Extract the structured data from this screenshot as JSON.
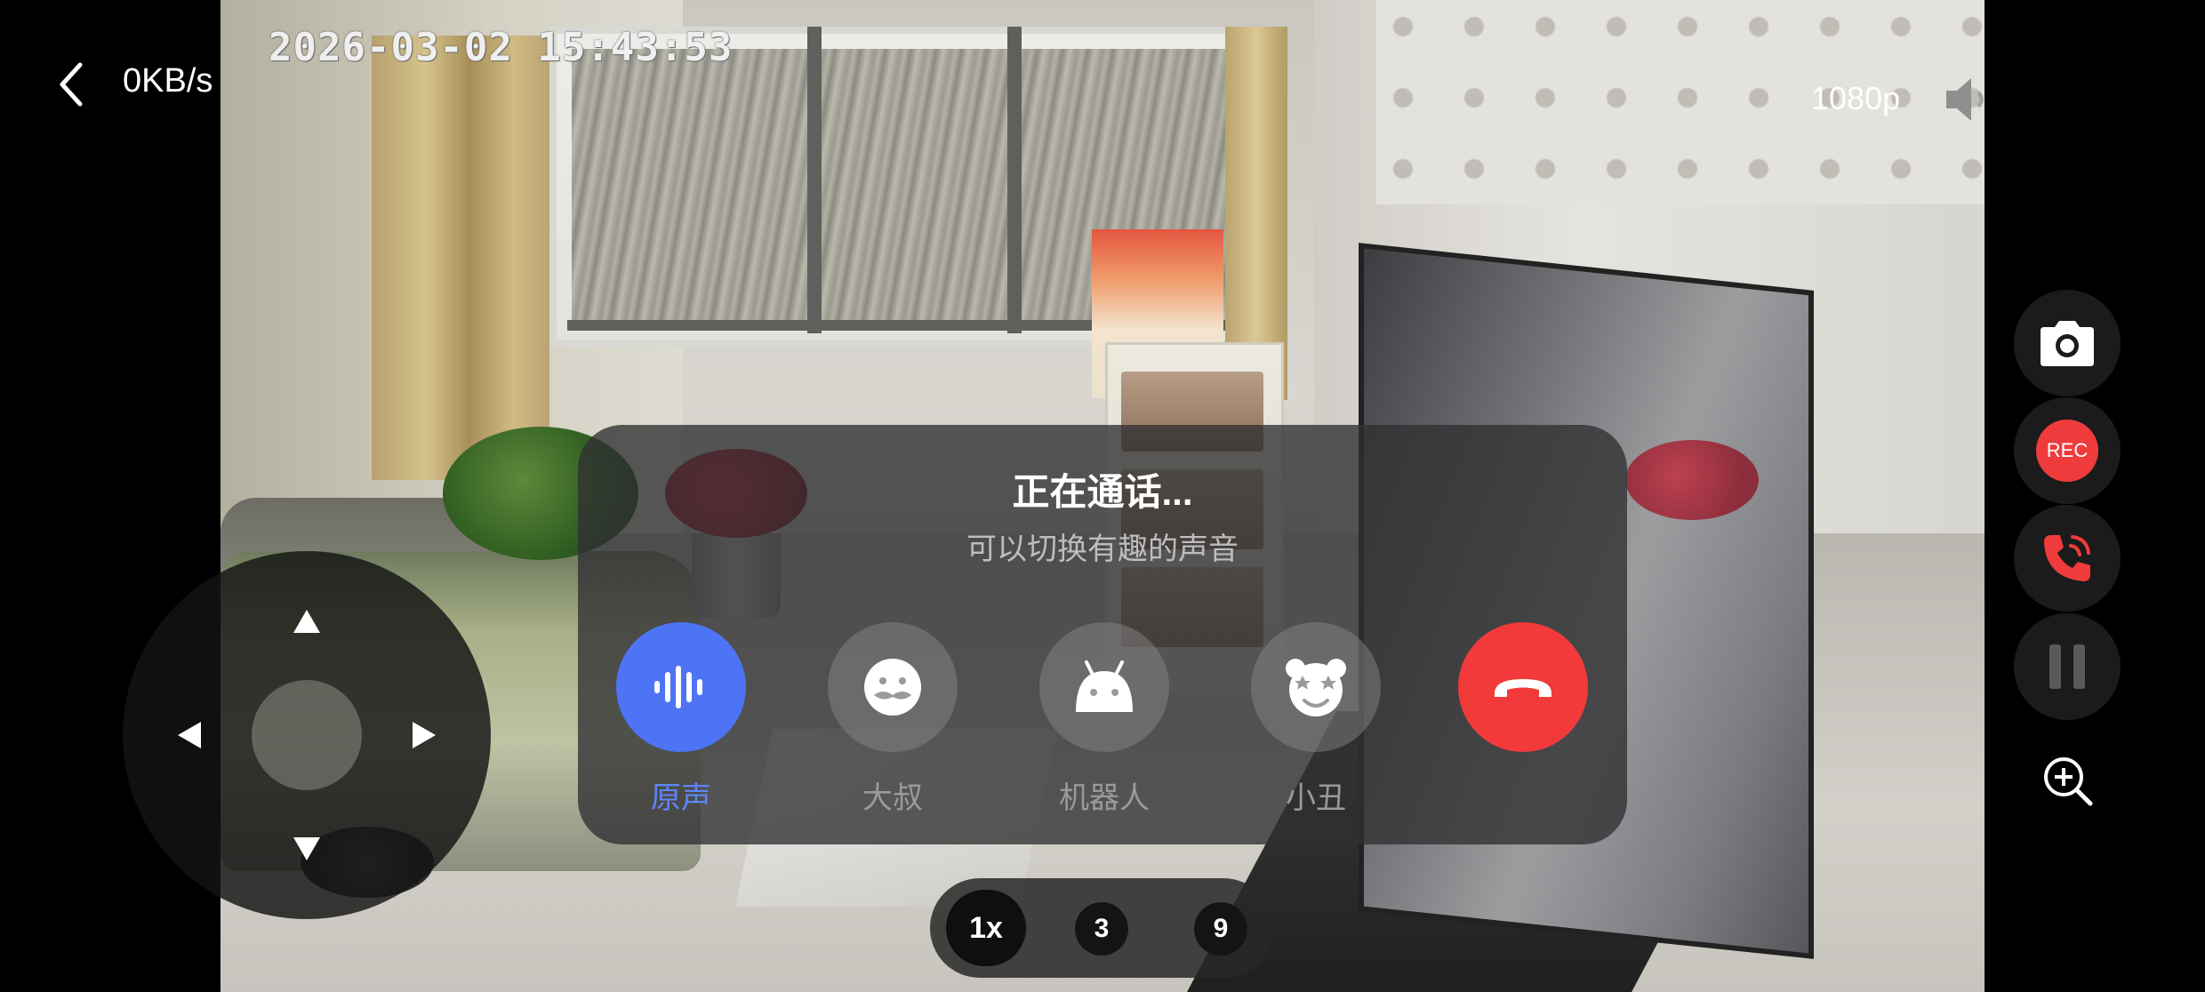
{
  "status": {
    "speed": "0KB/s",
    "timestamp": "2026-03-02  15:43:53",
    "resolution": "1080p"
  },
  "call": {
    "title": "正在通话...",
    "subtitle": "可以切换有趣的声音",
    "options": [
      {
        "label": "原声",
        "icon": "waveform-icon",
        "selected": true
      },
      {
        "label": "大叔",
        "icon": "mustache-face-icon",
        "selected": false
      },
      {
        "label": "机器人",
        "icon": "robot-icon",
        "selected": false
      },
      {
        "label": "小丑",
        "icon": "clown-bear-icon",
        "selected": false
      }
    ],
    "hangup_icon": "hang-up-icon"
  },
  "zoom": {
    "options": [
      "1x",
      "3",
      "9"
    ],
    "selected": "1x"
  },
  "side": {
    "rec_label": "REC"
  },
  "colors": {
    "accent_blue": "#4e74f6",
    "hangup_red": "#f23a3a",
    "rec_red": "#ef3b3b"
  }
}
